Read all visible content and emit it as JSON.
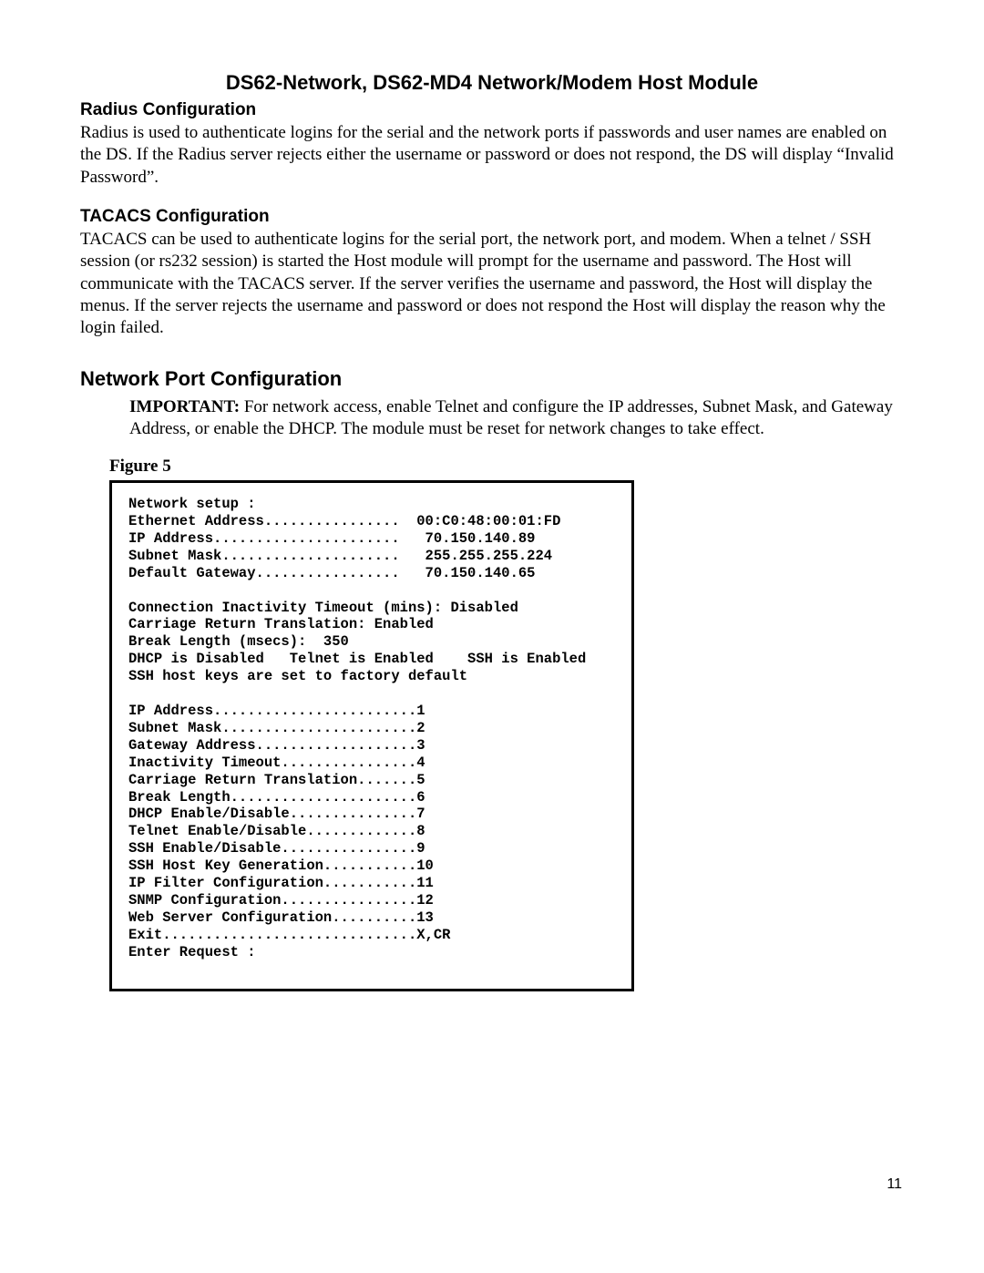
{
  "title": "DS62-Network, DS62-MD4 Network/Modem Host Module",
  "radius": {
    "heading": "Radius Configuration",
    "body": "Radius is used to authenticate logins for the serial and the network ports if passwords and user names are enabled on the DS. If the Radius server rejects either the username or password or does not respond, the DS will display “Invalid Password”."
  },
  "tacacs": {
    "heading": "TACACS Configuration",
    "body": "TACACS can be used to authenticate logins for the serial port, the network port, and modem. When a telnet / SSH session (or rs232 session) is started the Host module will prompt for the username and password.  The Host will communicate with the TACACS server.  If the server verifies the username and password, the Host will display the menus.  If the server rejects the username and password or does not respond the Host will display the reason why the login failed."
  },
  "network": {
    "heading": "Network Port Configuration",
    "important_label": "IMPORTANT:",
    "important_body": " For network access, enable Telnet and configure the IP addresses, Subnet Mask, and Gateway Address, or enable the DHCP. The module must be reset for network changes to take effect."
  },
  "figure_label": "Figure 5",
  "code_block": "Network setup :\nEthernet Address................  00:C0:48:00:01:FD\nIP Address......................   70.150.140.89\nSubnet Mask.....................   255.255.255.224\nDefault Gateway.................   70.150.140.65\n\nConnection Inactivity Timeout (mins): Disabled\nCarriage Return Translation: Enabled\nBreak Length (msecs):  350\nDHCP is Disabled   Telnet is Enabled    SSH is Enabled\nSSH host keys are set to factory default\n\nIP Address........................1\nSubnet Mask.......................2\nGateway Address...................3\nInactivity Timeout................4\nCarriage Return Translation.......5\nBreak Length......................6\nDHCP Enable/Disable...............7\nTelnet Enable/Disable.............8\nSSH Enable/Disable................9\nSSH Host Key Generation...........10\nIP Filter Configuration...........11\nSNMP Configuration................12\nWeb Server Configuration..........13\nExit..............................X,CR\nEnter Request :",
  "page_number": "11"
}
